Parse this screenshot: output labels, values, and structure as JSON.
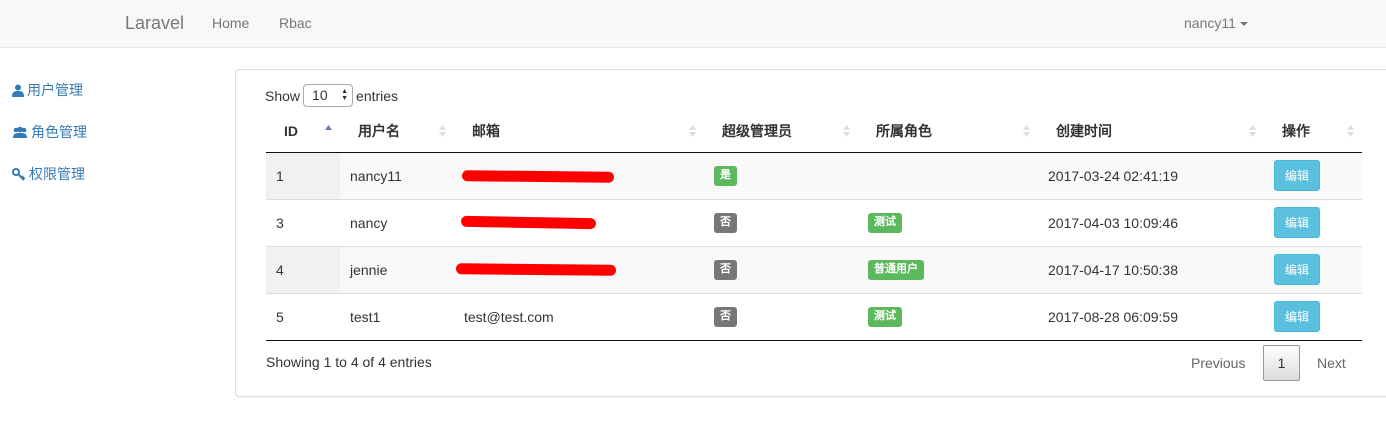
{
  "navbar": {
    "brand": "Laravel",
    "links": [
      "Home",
      "Rbac"
    ],
    "user": "nancy11"
  },
  "sidebar": {
    "items": [
      {
        "label": "用户管理",
        "icon": "user-icon"
      },
      {
        "label": "角色管理",
        "icon": "users-icon"
      },
      {
        "label": "权限管理",
        "icon": "key-icon"
      }
    ]
  },
  "length": {
    "show": "Show",
    "value": "10",
    "entries": "entries"
  },
  "table": {
    "headers": [
      "ID",
      "用户名",
      "邮箱",
      "超级管理员",
      "所属角色",
      "创建时间",
      "操作"
    ],
    "rows": [
      {
        "id": "1",
        "username": "nancy11",
        "email": "",
        "email_redacted": true,
        "super": "是",
        "super_yes": true,
        "role": "",
        "created": "2017-03-24 02:41:19",
        "action": "编辑"
      },
      {
        "id": "3",
        "username": "nancy",
        "email": "",
        "email_redacted": true,
        "super": "否",
        "super_yes": false,
        "role": "测试",
        "created": "2017-04-03 10:09:46",
        "action": "编辑"
      },
      {
        "id": "4",
        "username": "jennie",
        "email": "",
        "email_redacted": true,
        "super": "否",
        "super_yes": false,
        "role": "普通用户",
        "created": "2017-04-17 10:50:38",
        "action": "编辑"
      },
      {
        "id": "5",
        "username": "test1",
        "email": "test@test.com",
        "email_redacted": false,
        "super": "否",
        "super_yes": false,
        "role": "测试",
        "created": "2017-08-28 06:09:59",
        "action": "编辑"
      }
    ]
  },
  "footer": {
    "info": "Showing 1 to 4 of 4 entries",
    "previous": "Previous",
    "page": "1",
    "next": "Next"
  },
  "colors": {
    "link": "#337ab7",
    "success": "#5cb85c",
    "default": "#777777",
    "info": "#5bc0de",
    "redaction": "#ff0000"
  }
}
